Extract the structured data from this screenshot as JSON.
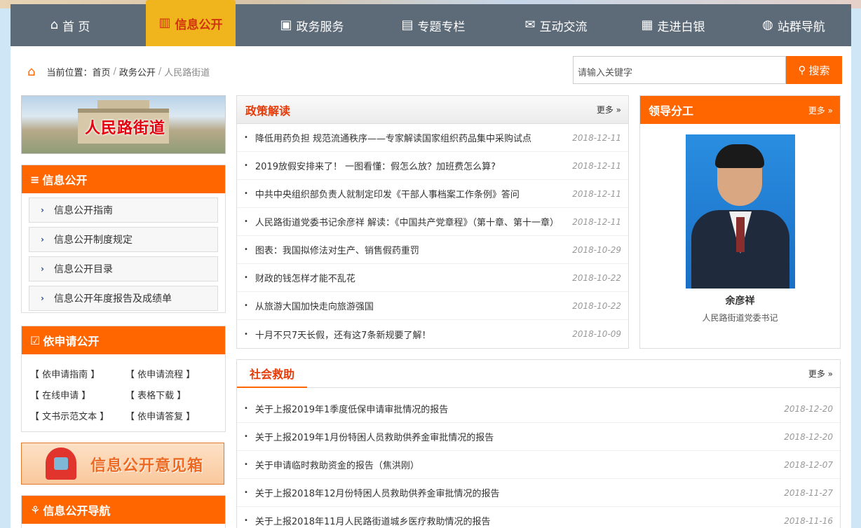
{
  "nav": [
    {
      "icon": "home-icon",
      "glyph": "⌂",
      "label": "首 页",
      "active": false
    },
    {
      "icon": "bar-chart-icon",
      "glyph": "▥",
      "label": "信息公开",
      "active": true
    },
    {
      "icon": "briefcase-icon",
      "glyph": "▣",
      "label": "政务服务",
      "active": false
    },
    {
      "icon": "book-icon",
      "glyph": "▤",
      "label": "专题专栏",
      "active": false
    },
    {
      "icon": "chat-icon",
      "glyph": "✉",
      "label": "互动交流",
      "active": false
    },
    {
      "icon": "building-icon",
      "glyph": "▦",
      "label": "走进白银",
      "active": false
    },
    {
      "icon": "globe-icon",
      "glyph": "◍",
      "label": "站群导航",
      "active": false
    }
  ],
  "breadcrumb": {
    "prefix": "当前位置：",
    "items": [
      "首页",
      "政务公开",
      "人民路街道"
    ],
    "sep": "/"
  },
  "search": {
    "placeholder": "请输入关键字",
    "button": "搜索"
  },
  "banner": {
    "text": "人民路街道"
  },
  "info_open": {
    "title": "信息公开",
    "items": [
      "信息公开指南",
      "信息公开制度规定",
      "信息公开目录",
      "信息公开年度报告及成绩单"
    ]
  },
  "apply_open": {
    "title": "依申请公开",
    "links": [
      "【 依申请指南 】",
      "【 依申请流程 】",
      "【 在线申请 】",
      "【 表格下载 】",
      "【 文书示范文本 】",
      "【 依申请答复 】"
    ]
  },
  "mailbox": {
    "text": "信息公开意见箱"
  },
  "info_nav": {
    "title": "信息公开导航"
  },
  "policy": {
    "title": "政策解读",
    "more": "更多 »",
    "items": [
      {
        "title": "降低用药负担 规范流通秩序——专家解读国家组织药品集中采购试点",
        "date": "2018-12-11"
      },
      {
        "title": "2019放假安排来了！ 一图看懂：假怎么放？加班费怎么算?",
        "date": "2018-12-11"
      },
      {
        "title": "中共中央组织部负责人就制定印发《干部人事档案工作条例》答问",
        "date": "2018-12-11"
      },
      {
        "title": "人民路街道党委书记余彦祥 解读：《中国共产党章程》（第十章、第十一章）",
        "date": "2018-12-11"
      },
      {
        "title": "图表：我国拟修法对生产、销售假药重罚",
        "date": "2018-10-29"
      },
      {
        "title": "财政的钱怎样才能不乱花",
        "date": "2018-10-22"
      },
      {
        "title": "从旅游大国加快走向旅游强国",
        "date": "2018-10-22"
      },
      {
        "title": "十月不只7天长假，还有这7条新规要了解！",
        "date": "2018-10-09"
      }
    ]
  },
  "leader": {
    "title": "领导分工",
    "more": "更多 »",
    "name": "余彦祥",
    "position": "人民路街道党委书记"
  },
  "social": {
    "title": "社会救助",
    "more": "更多 »",
    "items": [
      {
        "title": "关于上报2019年1季度低保申请审批情况的报告",
        "date": "2018-12-20"
      },
      {
        "title": "关于上报2019年1月份特困人员救助供养金审批情况的报告",
        "date": "2018-12-20"
      },
      {
        "title": "关于申请临时救助资金的报告（焦洪刚）",
        "date": "2018-12-07"
      },
      {
        "title": "关于上报2018年12月份特困人员救助供养金审批情况的报告",
        "date": "2018-11-27"
      },
      {
        "title": "关于上报2018年11月人民路街道城乡医疗救助情况的报告",
        "date": "2018-11-16"
      }
    ]
  }
}
